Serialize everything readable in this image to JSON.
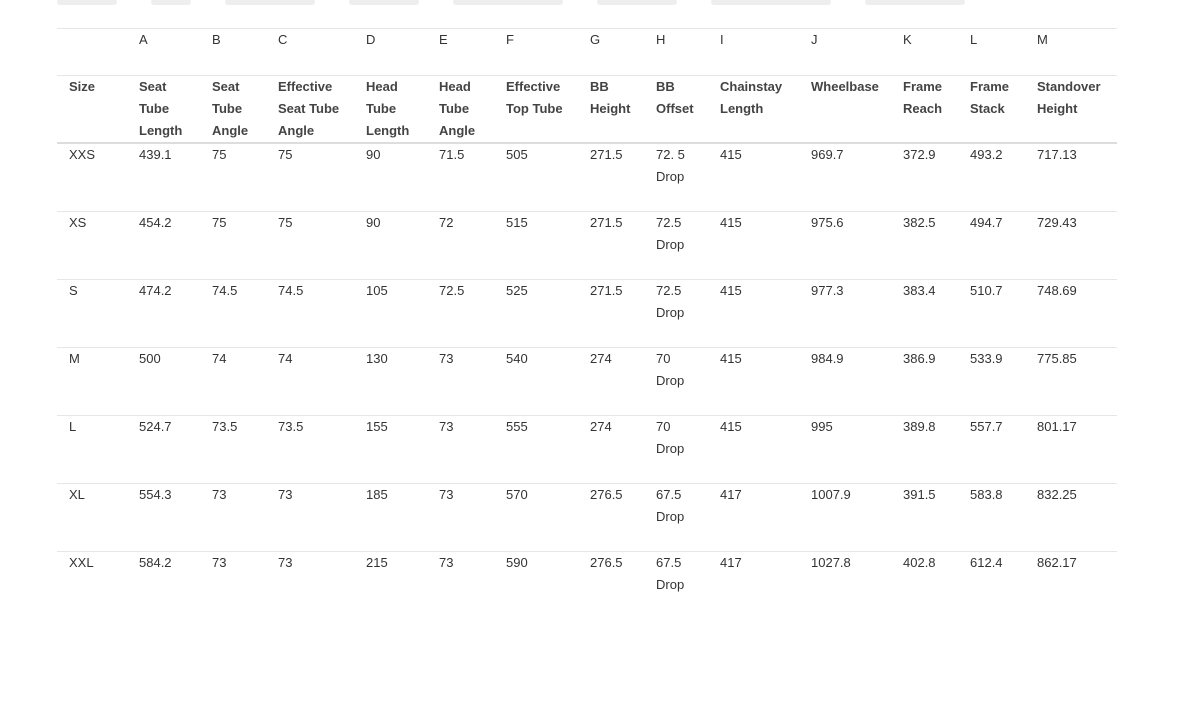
{
  "table": {
    "letters": [
      "",
      "A",
      "B",
      "C",
      "D",
      "E",
      "F",
      "G",
      "H",
      "I",
      "J",
      "K",
      "L",
      "M"
    ],
    "labels": [
      [
        "Size"
      ],
      [
        "Seat",
        "Tube",
        "Length"
      ],
      [
        "Seat",
        "Tube",
        "Angle"
      ],
      [
        "Effective",
        "Seat Tube",
        "Angle"
      ],
      [
        "Head",
        "Tube",
        "Length"
      ],
      [
        "Head",
        "Tube",
        "Angle"
      ],
      [
        "Effective",
        "Top Tube"
      ],
      [
        "BB",
        "Height"
      ],
      [
        "BB",
        "Offset"
      ],
      [
        "Chainstay",
        "Length"
      ],
      [
        "Wheelbase"
      ],
      [
        "Frame",
        "Reach"
      ],
      [
        "Frame",
        "Stack"
      ],
      [
        "Standover",
        "Height"
      ]
    ],
    "rows": [
      [
        "XXS",
        "439.1",
        "75",
        "75",
        "90",
        "71.5",
        "505",
        "271.5",
        [
          "72. 5",
          "Drop"
        ],
        "415",
        "969.7",
        "372.9",
        "493.2",
        "717.13"
      ],
      [
        "XS",
        "454.2",
        "75",
        "75",
        "90",
        "72",
        "515",
        "271.5",
        [
          "72.5",
          "Drop"
        ],
        "415",
        "975.6",
        "382.5",
        "494.7",
        "729.43"
      ],
      [
        "S",
        "474.2",
        "74.5",
        "74.5",
        "105",
        "72.5",
        "525",
        "271.5",
        [
          "72.5",
          "Drop"
        ],
        "415",
        "977.3",
        "383.4",
        "510.7",
        "748.69"
      ],
      [
        "M",
        "500",
        "74",
        "74",
        "130",
        "73",
        "540",
        "274",
        [
          "70",
          "Drop"
        ],
        "415",
        "984.9",
        "386.9",
        "533.9",
        "775.85"
      ],
      [
        "L",
        "524.7",
        "73.5",
        "73.5",
        "155",
        "73",
        "555",
        "274",
        [
          "70",
          "Drop"
        ],
        "415",
        "995",
        "389.8",
        "557.7",
        "801.17"
      ],
      [
        "XL",
        "554.3",
        "73",
        "73",
        "185",
        "73",
        "570",
        "276.5",
        [
          "67.5",
          "Drop"
        ],
        "417",
        "1007.9",
        "391.5",
        "583.8",
        "832.25"
      ],
      [
        "XXL",
        "584.2",
        "73",
        "73",
        "215",
        "73",
        "590",
        "276.5",
        [
          "67.5",
          "Drop"
        ],
        "417",
        "1027.8",
        "402.8",
        "612.4",
        "862.17"
      ]
    ]
  }
}
